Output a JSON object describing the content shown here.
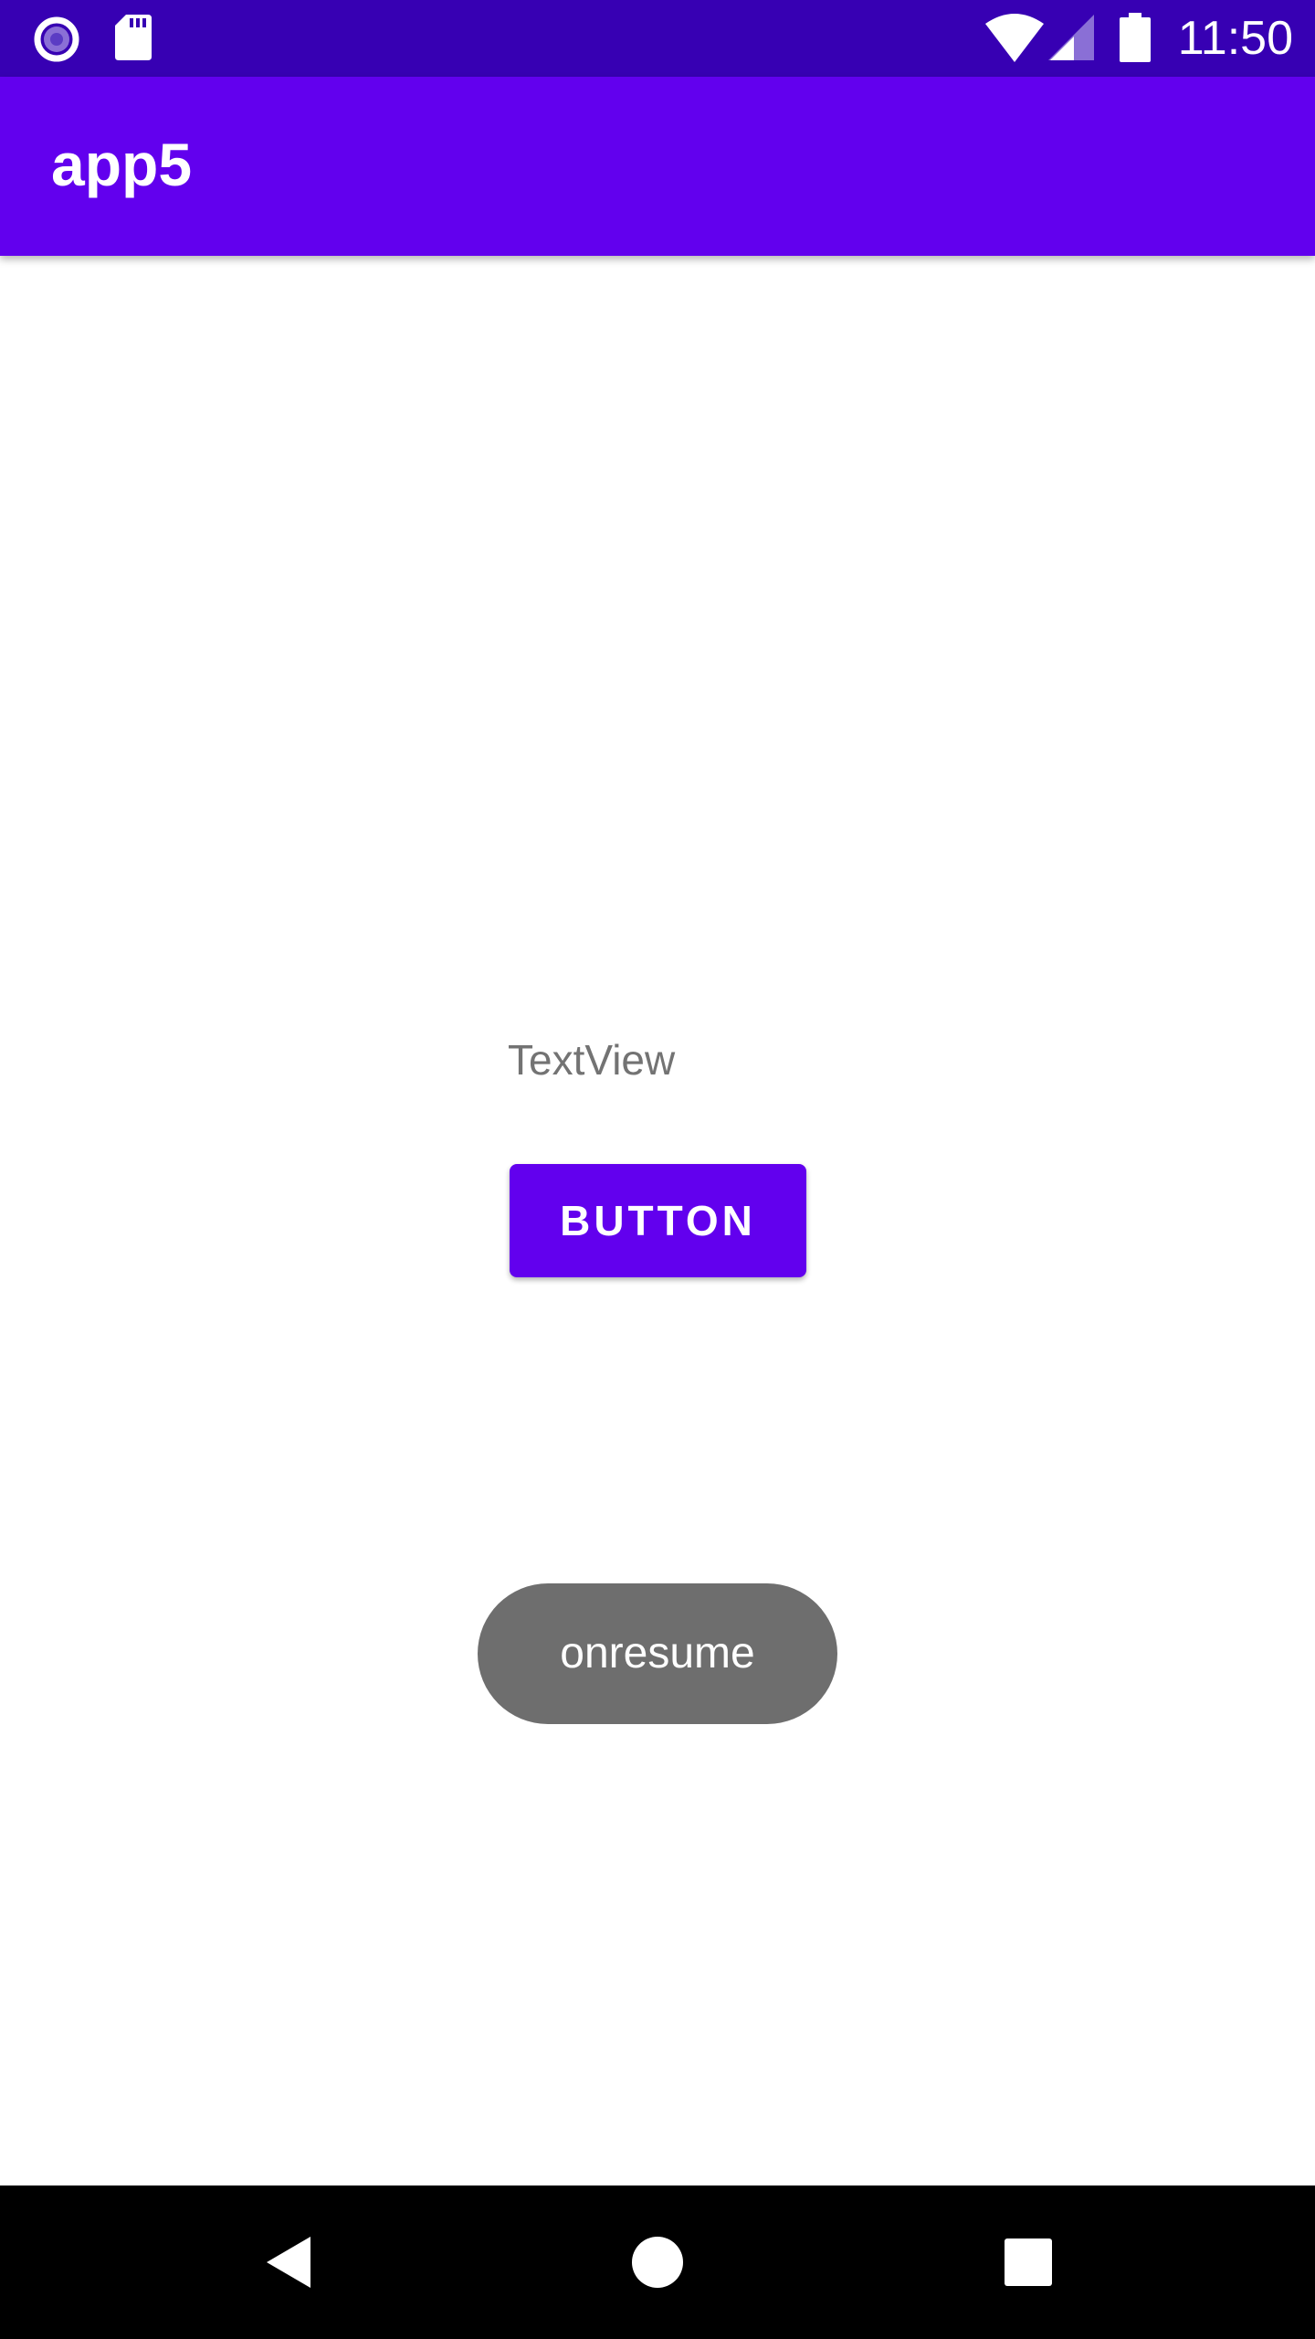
{
  "status_bar": {
    "time": "11:50",
    "icons": [
      "screen-record-icon",
      "sd-card-icon",
      "wifi-icon",
      "cell-signal-icon",
      "battery-icon"
    ],
    "background": "#3700b3"
  },
  "app_bar": {
    "title": "app5",
    "background": "#6200ee"
  },
  "main": {
    "text_view": "TextView",
    "button_label": "BUTTON",
    "button_color": "#6200ee"
  },
  "toast": {
    "message": "onresume"
  },
  "nav_bar": {
    "icons": [
      "back-icon",
      "home-icon",
      "recents-icon"
    ]
  }
}
